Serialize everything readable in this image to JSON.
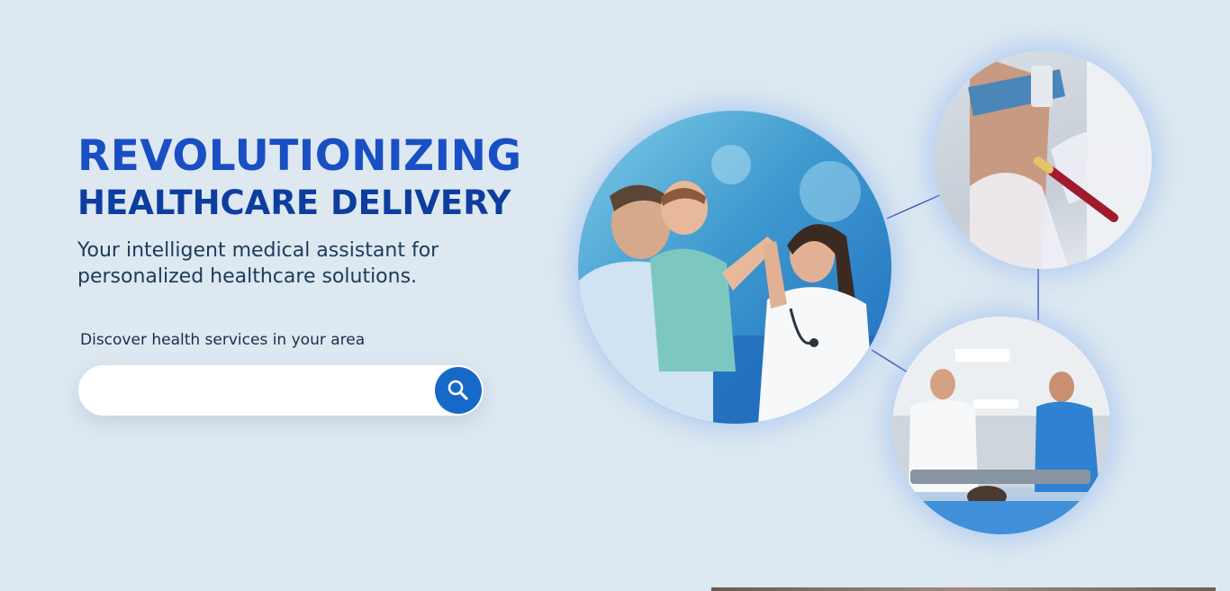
{
  "hero": {
    "title_line1": "REVOLUTIONIZING",
    "title_line2": "HEALTHCARE DELIVERY",
    "subtitle": "Your intelligent medical assistant for personalized healthcare solutions."
  },
  "search": {
    "label": "Discover health services in your area",
    "value": "",
    "placeholder": "",
    "button_icon": "search-icon"
  },
  "colors": {
    "background": "#dde8f1",
    "title_primary": "#1a4fc4",
    "title_secondary": "#0d3d9e",
    "button": "#1669c8",
    "connector_line": "#3b4fb8"
  },
  "images": [
    "father-child-doctor-high-five-photo",
    "blood-draw-photo",
    "hospital-ward-doctors-photo"
  ]
}
